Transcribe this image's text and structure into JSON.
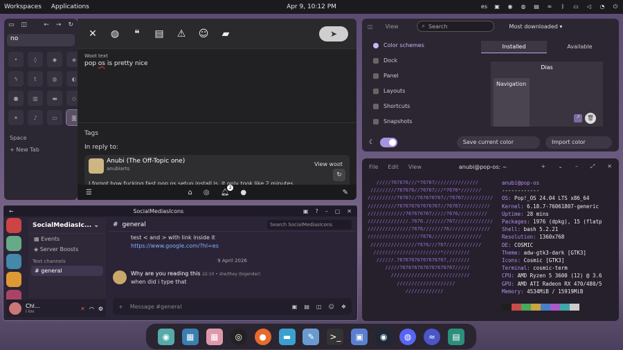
{
  "topbar": {
    "workspaces": "Workspaces",
    "applications": "Applications",
    "clock": "Apr 9, 10:12 PM",
    "lang": "es"
  },
  "browser": {
    "url_value": "no",
    "space_label": "Space",
    "new_tab": "+  New Tab"
  },
  "woot": {
    "label": "Woot text",
    "text_before": "pop ",
    "text_misspelled": "os",
    "text_after": " is pretty nice",
    "tags": "Tags",
    "in_reply_to": "In reply to:",
    "reply_name": "Anubi (The Off-Topic one)",
    "reply_handle": "anubiarts",
    "view_woot": "View woot",
    "reply_body": "I forgot how fucking fast pop os setup install is, it only took like 2 minutes",
    "notif_badge": "2"
  },
  "settings": {
    "view": "View",
    "search_placeholder": "Search",
    "sort": "Most downloaded",
    "nav": [
      "Color schemes",
      "Dock",
      "Panel",
      "Layouts",
      "Shortcuts",
      "Snapshots"
    ],
    "tab_installed": "Installed",
    "tab_available": "Available",
    "preview_title": "Dias",
    "preview_nav": "Navigation",
    "save_scheme": "Save current color scheme",
    "import_scheme": "Import color scheme"
  },
  "terminal": {
    "menu_file": "File",
    "menu_edit": "Edit",
    "menu_view": "View",
    "title": "anubi@pop-os: ~",
    "art": [
      "   /////767676///*76767///////////////",
      " /////////767676//76767///*7676*///////",
      "//////////76767//767676767//76767//////////",
      "//////////767676767676767//76767//////////",
      "/////////////767676767/////7676//////////",
      "//////////////.7676.///////767/////////////",
      "///////////////7676///////76//////////////",
      "//////////////////7676/////////////////",
      " ////////////////7676///767////////////",
      "  ///////////////////////*/////////",
      "   //////.76767676767676767,///////",
      "      /////7676767676767676767/////",
      "        ///////////////////////////",
      "          ////////////////////",
      "             /////////////"
    ],
    "user": "anubi@pop-os",
    "sep": "------------",
    "fields": [
      {
        "k": "OS:",
        "v": " Pop!_OS 24.04 LTS x86_64"
      },
      {
        "k": "Kernel:",
        "v": " 6.18.7-76061807-generic"
      },
      {
        "k": "Uptime:",
        "v": " 28 mins"
      },
      {
        "k": "Packages:",
        "v": " 1976 (dpkg), 15 (flatp"
      },
      {
        "k": "Shell:",
        "v": " bash 5.2.21"
      },
      {
        "k": "Resolution:",
        "v": " 1360x768"
      },
      {
        "k": "DE:",
        "v": " COSMIC"
      },
      {
        "k": "Theme:",
        "v": " adw-gtk3-dark [GTK3]"
      },
      {
        "k": "Icons:",
        "v": " Cosmic [GTK3]"
      },
      {
        "k": "Terminal:",
        "v": " cosmic-term"
      },
      {
        "k": "CPU:",
        "v": " AMD Ryzen 5 3600 (12) @ 3.6"
      },
      {
        "k": "GPU:",
        "v": " AMD ATI Radeon RX 470/480/5"
      },
      {
        "k": "Memory:",
        "v": " 4534MiB / 15919MiB"
      }
    ],
    "swatch_colors": [
      "#1e1e1e",
      "#c94c4c",
      "#4aa85a",
      "#c9a440",
      "#4a7ec9",
      "#a85ac9",
      "#40a8a8",
      "#cccccc"
    ]
  },
  "chat": {
    "window_title": "SocialMediasIcons",
    "server_name": "SocialMediasIc...",
    "events": "Events",
    "boosts": "Server Boosts",
    "text_channels": "Text channels",
    "channel": "general",
    "channel_header": "general",
    "search_placeholder": "Search SocialMediasIcons",
    "msg1": "test < and > with link inside it",
    "msg1_link": "https://www.google.com/?hl=es",
    "date_divider": "9 April 2026",
    "msg2_author": "Why are you reading this",
    "msg2_meta": "22:10 • she/they (bigender)",
    "msg2_text": "when did i type that",
    "compose_placeholder": "Message #general",
    "user_name": "Chl...",
    "user_status": "I lov"
  },
  "colors": {
    "accent": "#bba8e8",
    "topbar_bg": "#1b1b1f"
  }
}
